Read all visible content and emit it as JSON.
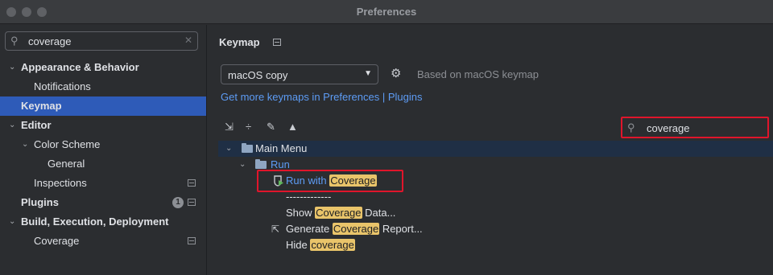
{
  "window": {
    "title": "Preferences"
  },
  "sidebar": {
    "search_value": "coverage",
    "items": [
      {
        "label": "Appearance & Behavior"
      },
      {
        "label": "Notifications"
      },
      {
        "label": "Keymap"
      },
      {
        "label": "Editor"
      },
      {
        "label": "Color Scheme"
      },
      {
        "label": "General"
      },
      {
        "label": "Inspections"
      },
      {
        "label": "Plugins",
        "badge": "1"
      },
      {
        "label": "Build, Execution, Deployment"
      },
      {
        "label": "Coverage"
      }
    ]
  },
  "main": {
    "title": "Keymap",
    "keymap_select": "macOS copy",
    "based_on": "Based on macOS keymap",
    "link": "Get more keymaps in Preferences | Plugins",
    "filter_value": "coverage",
    "tree": {
      "main_menu": "Main Menu",
      "run": "Run",
      "run_with_prefix": "Run with ",
      "run_with_match": "Coverage",
      "separator": "-------------",
      "show_prefix": "Show ",
      "show_match": "Coverage",
      "show_suffix": " Data...",
      "generate_prefix": "Generate ",
      "generate_match": "Coverage",
      "generate_suffix": " Report...",
      "hide_prefix": "Hide ",
      "hide_match": "coverage"
    }
  },
  "colors": {
    "accent": "#2e5bb8",
    "link": "#5d9cf5",
    "highlight": "#e9c46a",
    "annotation_red": "#e0152b"
  }
}
